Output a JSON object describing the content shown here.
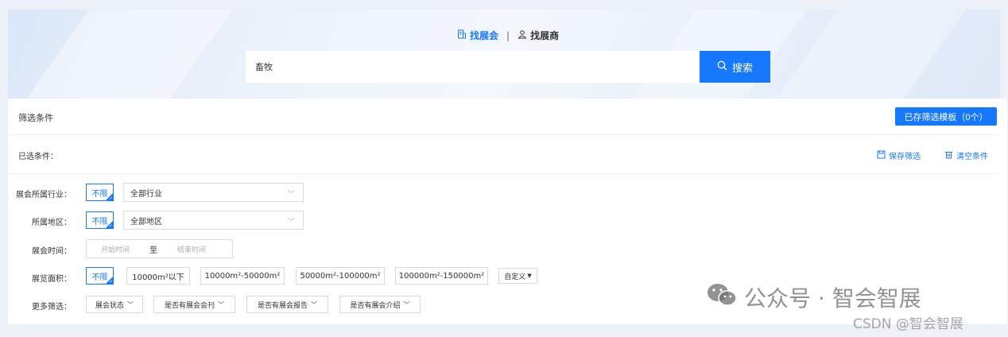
{
  "hero": {
    "tabs": [
      {
        "label": "找展会",
        "icon": "building-icon"
      },
      {
        "label": "找展商",
        "icon": "user-icon"
      }
    ],
    "tab_separator": "|",
    "search_value": "畜牧",
    "search_button": "搜索"
  },
  "filters": {
    "title": "筛选条件",
    "template_button": "已存筛选模板（0个）",
    "selected_label": "已选条件：",
    "save_label": "保存筛选",
    "clear_label": "清空条件",
    "industry": {
      "label": "展会所属行业：",
      "unlimited": "不限",
      "select": "全部行业"
    },
    "region": {
      "label": "所属地区：",
      "unlimited": "不限",
      "select": "全部地区"
    },
    "time": {
      "label": "展会时间：",
      "start": "开始时间",
      "to": "至",
      "end": "结束时间"
    },
    "area": {
      "label": "展览面积：",
      "unlimited": "不限",
      "options": [
        "10000m²以下",
        "10000m²-50000m²",
        "50000m²-100000m²",
        "100000m²-150000m²"
      ],
      "custom": "自定义"
    },
    "more": {
      "label": "更多筛选：",
      "options": [
        "展会状态",
        "是否有展会会刊",
        "是否有展会报告",
        "是否有展会介绍"
      ]
    }
  },
  "watermark": {
    "line1": "公众号 · 智会智展",
    "line2": "CSDN @智会智展"
  },
  "colors": {
    "accent": "#1677ff",
    "background": "#edf1f7"
  }
}
